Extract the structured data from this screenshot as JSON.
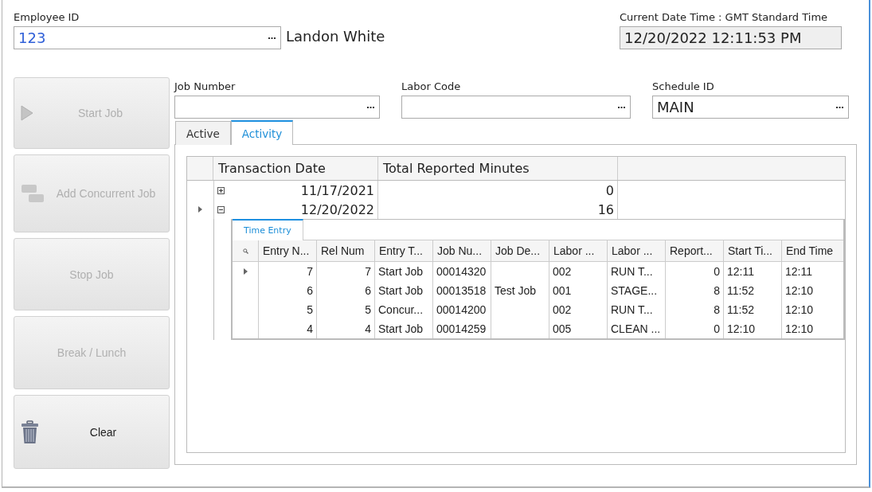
{
  "employee": {
    "label": "Employee ID",
    "value": "123",
    "name": "Landon White"
  },
  "clock": {
    "label": "Current Date Time : GMT Standard Time",
    "value": "12/20/2022 12:11:53 PM"
  },
  "actions": [
    {
      "label": "Start Job",
      "kind": "start",
      "disabled": true
    },
    {
      "label": "Add Concurrent Job",
      "kind": "concurrent",
      "disabled": true
    },
    {
      "label": "Stop Job",
      "kind": "plain",
      "disabled": true
    },
    {
      "label": "Break / Lunch",
      "kind": "plain",
      "disabled": true
    },
    {
      "label": "Clear",
      "kind": "clear",
      "disabled": false
    }
  ],
  "fields": [
    {
      "label": "Job Number"
    },
    {
      "label": "Labor Code"
    },
    {
      "label": "Schedule ID",
      "value": "MAIN"
    }
  ],
  "tabs": [
    {
      "label": "Active",
      "selected": false
    },
    {
      "label": "Activity",
      "selected": true
    }
  ],
  "activity_grid": {
    "columns": [
      "Transaction Date",
      "Total Reported Minutes"
    ],
    "rows": [
      {
        "date": "11/17/2021",
        "minutes": "0",
        "expanded": false,
        "current": false
      },
      {
        "date": "12/20/2022",
        "minutes": "16",
        "expanded": true,
        "current": true,
        "detail": {
          "tabs": [
            {
              "label": "Time Entry",
              "selected": true
            }
          ],
          "columns": [
            {
              "label": "Entry N...",
              "kind": "number"
            },
            {
              "label": "Rel Num",
              "kind": "number"
            },
            {
              "label": "Entry T...",
              "kind": "text"
            },
            {
              "label": "Job Nu...",
              "kind": "text"
            },
            {
              "label": "Job De...",
              "kind": "text"
            },
            {
              "label": "Labor ...",
              "kind": "text"
            },
            {
              "label": "Labor ...",
              "kind": "text"
            },
            {
              "label": "Report...",
              "kind": "number"
            },
            {
              "label": "Start Ti...",
              "kind": "text"
            },
            {
              "label": "End Time",
              "kind": "text"
            }
          ],
          "rows": [
            {
              "current": true,
              "cells": [
                "7",
                "7",
                "Start Job",
                "00014320",
                null,
                "002",
                "RUN T...",
                "0",
                "12:11",
                "12:11"
              ]
            },
            {
              "current": false,
              "cells": [
                "6",
                "6",
                "Start Job",
                "00013518",
                "Test Job",
                "001",
                "STAGE...",
                "8",
                "11:52",
                "12:10"
              ]
            },
            {
              "current": false,
              "cells": [
                "5",
                "5",
                "Concur...",
                "00014200",
                null,
                "002",
                "RUN T...",
                "8",
                "11:52",
                "12:10"
              ]
            },
            {
              "current": false,
              "cells": [
                "4",
                "4",
                "Start Job",
                "00014259",
                null,
                "005",
                "CLEAN ...",
                "0",
                "12:10",
                "12:10"
              ]
            }
          ]
        }
      }
    ]
  }
}
